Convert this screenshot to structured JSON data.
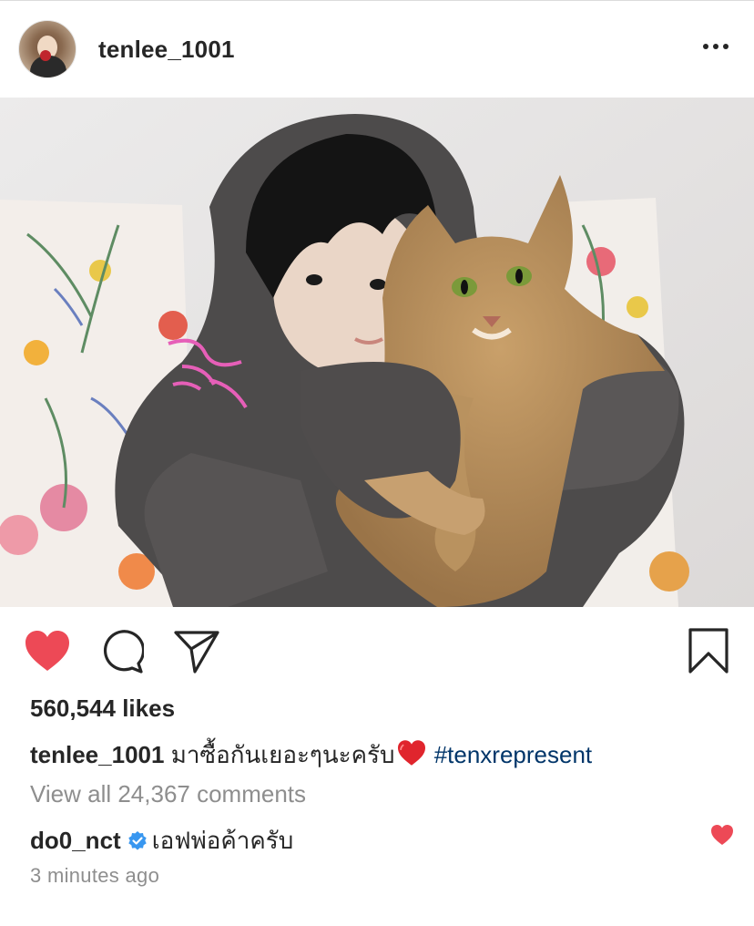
{
  "post": {
    "username": "tenlee_1001",
    "menu_icon": "more-horizontal-icon",
    "photo_alt": "tenlee_1001 post photo"
  },
  "actions": {
    "like_icon": "heart-filled-icon",
    "like_color": "#ed4956",
    "comment_icon": "comment-icon",
    "share_icon": "send-icon",
    "save_icon": "bookmark-icon"
  },
  "likes": {
    "text": "560,544 likes"
  },
  "caption": {
    "username": "tenlee_1001",
    "text": "มาซื้อกันเยอะๆนะครับ",
    "emoji": "❤️",
    "hashtag": "#tenxrepresent"
  },
  "comments": {
    "view_all": "View all 24,367 comments",
    "items": [
      {
        "username": "do0_nct",
        "verified": true,
        "text": "เอฟพ่อค้าครับ",
        "liked": true
      }
    ]
  },
  "timestamp": "3 minutes ago",
  "colors": {
    "text": "#262626",
    "secondary": "#8e8e8e",
    "hashtag": "#003569",
    "verified": "#3897f0",
    "like": "#ed4956"
  }
}
